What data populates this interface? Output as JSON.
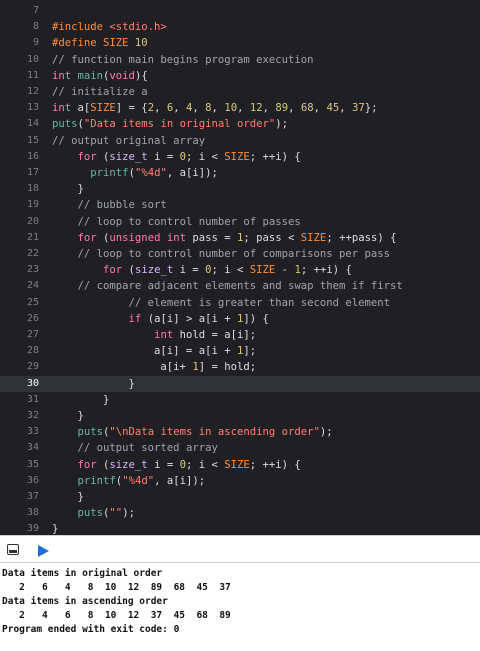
{
  "editor": {
    "current_line": "30",
    "lines": [
      {
        "n": "7",
        "tokens": []
      },
      {
        "n": "8",
        "tokens": [
          {
            "c": "t-pp",
            "t": "#include "
          },
          {
            "c": "t-str",
            "t": "<stdio.h>"
          }
        ]
      },
      {
        "n": "9",
        "tokens": [
          {
            "c": "t-pp",
            "t": "#define SIZE "
          },
          {
            "c": "t-num",
            "t": "10"
          }
        ]
      },
      {
        "n": "10",
        "tokens": [
          {
            "c": "t-cmt",
            "t": "// function main begins program execution"
          }
        ]
      },
      {
        "n": "11",
        "tokens": [
          {
            "c": "t-kw",
            "t": "int "
          },
          {
            "c": "t-fn",
            "t": "main"
          },
          {
            "c": "t-pl",
            "t": "("
          },
          {
            "c": "t-kw",
            "t": "void"
          },
          {
            "c": "t-pl",
            "t": "){"
          }
        ]
      },
      {
        "n": "12",
        "tokens": [
          {
            "c": "t-cmt",
            "t": "// initialize a"
          }
        ]
      },
      {
        "n": "13",
        "tokens": [
          {
            "c": "t-kw",
            "t": "int "
          },
          {
            "c": "t-pl",
            "t": "a["
          },
          {
            "c": "t-pp",
            "t": "SIZE"
          },
          {
            "c": "t-pl",
            "t": "] = {"
          },
          {
            "c": "t-num",
            "t": "2"
          },
          {
            "c": "t-pl",
            "t": ", "
          },
          {
            "c": "t-num",
            "t": "6"
          },
          {
            "c": "t-pl",
            "t": ", "
          },
          {
            "c": "t-num",
            "t": "4"
          },
          {
            "c": "t-pl",
            "t": ", "
          },
          {
            "c": "t-num",
            "t": "8"
          },
          {
            "c": "t-pl",
            "t": ", "
          },
          {
            "c": "t-num",
            "t": "10"
          },
          {
            "c": "t-pl",
            "t": ", "
          },
          {
            "c": "t-num",
            "t": "12"
          },
          {
            "c": "t-pl",
            "t": ", "
          },
          {
            "c": "t-num",
            "t": "89"
          },
          {
            "c": "t-pl",
            "t": ", "
          },
          {
            "c": "t-num",
            "t": "68"
          },
          {
            "c": "t-pl",
            "t": ", "
          },
          {
            "c": "t-num",
            "t": "45"
          },
          {
            "c": "t-pl",
            "t": ", "
          },
          {
            "c": "t-num",
            "t": "37"
          },
          {
            "c": "t-pl",
            "t": "};"
          }
        ]
      },
      {
        "n": "14",
        "tokens": [
          {
            "c": "t-fn",
            "t": "puts"
          },
          {
            "c": "t-pl",
            "t": "("
          },
          {
            "c": "t-str",
            "t": "\"Data items in original order\""
          },
          {
            "c": "t-pl",
            "t": ");"
          }
        ]
      },
      {
        "n": "15",
        "tokens": [
          {
            "c": "t-cmt",
            "t": "// output original array"
          }
        ]
      },
      {
        "n": "16",
        "tokens": [
          {
            "c": "t-pl",
            "t": "    "
          },
          {
            "c": "t-kw",
            "t": "for "
          },
          {
            "c": "t-pl",
            "t": "("
          },
          {
            "c": "t-ty",
            "t": "size_t "
          },
          {
            "c": "t-pl",
            "t": "i = "
          },
          {
            "c": "t-num",
            "t": "0"
          },
          {
            "c": "t-pl",
            "t": "; i < "
          },
          {
            "c": "t-pp",
            "t": "SIZE"
          },
          {
            "c": "t-pl",
            "t": "; ++i) {"
          }
        ]
      },
      {
        "n": "17",
        "tokens": [
          {
            "c": "t-pl",
            "t": "      "
          },
          {
            "c": "t-fn",
            "t": "printf"
          },
          {
            "c": "t-pl",
            "t": "("
          },
          {
            "c": "t-str",
            "t": "\"%4d\""
          },
          {
            "c": "t-pl",
            "t": ", a[i]);"
          }
        ]
      },
      {
        "n": "18",
        "tokens": [
          {
            "c": "t-pl",
            "t": "    }"
          }
        ]
      },
      {
        "n": "19",
        "tokens": [
          {
            "c": "t-pl",
            "t": "    "
          },
          {
            "c": "t-cmt",
            "t": "// bubble sort"
          }
        ]
      },
      {
        "n": "20",
        "tokens": [
          {
            "c": "t-pl",
            "t": "    "
          },
          {
            "c": "t-cmt",
            "t": "// loop to control number of passes"
          }
        ]
      },
      {
        "n": "21",
        "tokens": [
          {
            "c": "t-pl",
            "t": "    "
          },
          {
            "c": "t-kw",
            "t": "for "
          },
          {
            "c": "t-pl",
            "t": "("
          },
          {
            "c": "t-kw",
            "t": "unsigned int "
          },
          {
            "c": "t-pl",
            "t": "pass = "
          },
          {
            "c": "t-num",
            "t": "1"
          },
          {
            "c": "t-pl",
            "t": "; pass < "
          },
          {
            "c": "t-pp",
            "t": "SIZE"
          },
          {
            "c": "t-pl",
            "t": "; ++pass) {"
          }
        ]
      },
      {
        "n": "22",
        "tokens": [
          {
            "c": "t-pl",
            "t": "    "
          },
          {
            "c": "t-cmt",
            "t": "// loop to control number of comparisons per pass"
          }
        ]
      },
      {
        "n": "23",
        "tokens": [
          {
            "c": "t-pl",
            "t": "        "
          },
          {
            "c": "t-kw",
            "t": "for "
          },
          {
            "c": "t-pl",
            "t": "("
          },
          {
            "c": "t-ty",
            "t": "size_t "
          },
          {
            "c": "t-pl",
            "t": "i = "
          },
          {
            "c": "t-num",
            "t": "0"
          },
          {
            "c": "t-pl",
            "t": "; i < "
          },
          {
            "c": "t-pp",
            "t": "SIZE"
          },
          {
            "c": "t-pl",
            "t": " - "
          },
          {
            "c": "t-num",
            "t": "1"
          },
          {
            "c": "t-pl",
            "t": "; ++i) {"
          }
        ]
      },
      {
        "n": "24",
        "tokens": [
          {
            "c": "t-pl",
            "t": "    "
          },
          {
            "c": "t-cmt",
            "t": "// compare adjacent elements and swap them if first"
          }
        ]
      },
      {
        "n": "25",
        "tokens": [
          {
            "c": "t-pl",
            "t": "            "
          },
          {
            "c": "t-cmt",
            "t": "// element is greater than second element"
          }
        ]
      },
      {
        "n": "26",
        "tokens": [
          {
            "c": "t-pl",
            "t": "            "
          },
          {
            "c": "t-kw",
            "t": "if "
          },
          {
            "c": "t-pl",
            "t": "(a[i] > a[i + "
          },
          {
            "c": "t-num",
            "t": "1"
          },
          {
            "c": "t-pl",
            "t": "]) {"
          }
        ]
      },
      {
        "n": "27",
        "tokens": [
          {
            "c": "t-pl",
            "t": "                "
          },
          {
            "c": "t-kw",
            "t": "int "
          },
          {
            "c": "t-pl",
            "t": "hold = a[i];"
          }
        ]
      },
      {
        "n": "28",
        "tokens": [
          {
            "c": "t-pl",
            "t": "                a[i] = a[i + "
          },
          {
            "c": "t-num",
            "t": "1"
          },
          {
            "c": "t-pl",
            "t": "];"
          }
        ]
      },
      {
        "n": "29",
        "tokens": [
          {
            "c": "t-pl",
            "t": "                 a[i+ "
          },
          {
            "c": "t-num",
            "t": "1"
          },
          {
            "c": "t-pl",
            "t": "] = hold;"
          }
        ]
      },
      {
        "n": "30",
        "tokens": [
          {
            "c": "t-pl",
            "t": "            }"
          }
        ]
      },
      {
        "n": "31",
        "tokens": [
          {
            "c": "t-pl",
            "t": "        }"
          }
        ]
      },
      {
        "n": "32",
        "tokens": [
          {
            "c": "t-pl",
            "t": "    }"
          }
        ]
      },
      {
        "n": "33",
        "tokens": [
          {
            "c": "t-pl",
            "t": "    "
          },
          {
            "c": "t-fn",
            "t": "puts"
          },
          {
            "c": "t-pl",
            "t": "("
          },
          {
            "c": "t-str",
            "t": "\"\\nData items in ascending order\""
          },
          {
            "c": "t-pl",
            "t": ");"
          }
        ]
      },
      {
        "n": "34",
        "tokens": [
          {
            "c": "t-pl",
            "t": "    "
          },
          {
            "c": "t-cmt",
            "t": "// output sorted array"
          }
        ]
      },
      {
        "n": "35",
        "tokens": [
          {
            "c": "t-pl",
            "t": "    "
          },
          {
            "c": "t-kw",
            "t": "for "
          },
          {
            "c": "t-pl",
            "t": "("
          },
          {
            "c": "t-ty",
            "t": "size_t "
          },
          {
            "c": "t-pl",
            "t": "i = "
          },
          {
            "c": "t-num",
            "t": "0"
          },
          {
            "c": "t-pl",
            "t": "; i < "
          },
          {
            "c": "t-pp",
            "t": "SIZE"
          },
          {
            "c": "t-pl",
            "t": "; ++i) {"
          }
        ]
      },
      {
        "n": "36",
        "tokens": [
          {
            "c": "t-pl",
            "t": "    "
          },
          {
            "c": "t-fn",
            "t": "printf"
          },
          {
            "c": "t-pl",
            "t": "("
          },
          {
            "c": "t-str",
            "t": "\"%4d\""
          },
          {
            "c": "t-pl",
            "t": ", a[i]);"
          }
        ]
      },
      {
        "n": "37",
        "tokens": [
          {
            "c": "t-pl",
            "t": "    }"
          }
        ]
      },
      {
        "n": "38",
        "tokens": [
          {
            "c": "t-pl",
            "t": "    "
          },
          {
            "c": "t-fn",
            "t": "puts"
          },
          {
            "c": "t-pl",
            "t": "("
          },
          {
            "c": "t-str",
            "t": "\"\""
          },
          {
            "c": "t-pl",
            "t": ");"
          }
        ]
      },
      {
        "n": "39",
        "tokens": [
          {
            "c": "t-pl",
            "t": "}"
          }
        ]
      }
    ]
  },
  "debug_bar": {
    "hide_icon": "panel-toggle-icon",
    "run_icon": "run-indicator-icon",
    "accent_color": "#1e6fd9"
  },
  "console": {
    "lines": [
      "Data items in original order",
      "   2   6   4   8  10  12  89  68  45  37",
      "Data items in ascending order",
      "   2   4   6   8  10  12  37  45  68  89",
      "Program ended with exit code: 0"
    ]
  }
}
